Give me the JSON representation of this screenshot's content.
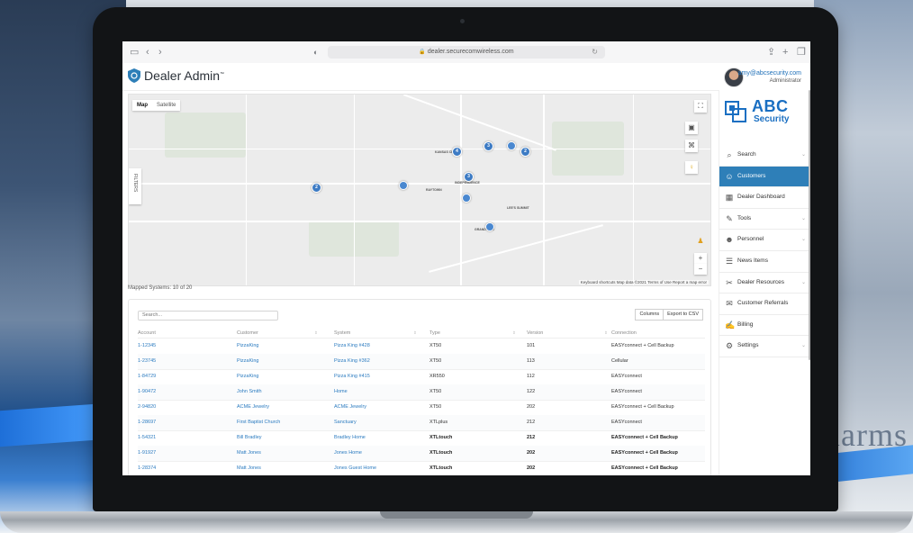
{
  "background": {
    "right_text": "larms"
  },
  "browser": {
    "url": "dealer.securecomwireless.com",
    "icons": {
      "sidebar": "sidebar-toggle-icon",
      "back": "chevron-left-icon",
      "forward": "chevron-right-icon",
      "privacy": "shield-half-icon",
      "reload": "reload-icon",
      "share": "share-icon",
      "new_tab": "plus-icon",
      "tabs": "tabs-icon"
    }
  },
  "header": {
    "title": "Dealer Admin",
    "trademark": "™",
    "user_email": "amy@abcsecurity.com",
    "user_role": "Administrator"
  },
  "map": {
    "tabs": [
      "Map",
      "Satellite"
    ],
    "active_tab": "Map",
    "filters_label": "FILTERS",
    "clusters": [
      "4",
      "3",
      "2",
      "3",
      "2"
    ],
    "footer": "Keyboard shortcuts   Map data ©2021   Terms of Use   Report a map error",
    "mapped_systems": "Mapped Systems: 10 of 20",
    "zoom_in": "+",
    "zoom_out": "−"
  },
  "table": {
    "search_placeholder": "Search...",
    "buttons": {
      "columns": "Columns",
      "export": "Export to CSV"
    },
    "headers": [
      "Account",
      "Customer",
      "System",
      "Type",
      "Version",
      "Connection"
    ],
    "rows": [
      {
        "account": "1-12345",
        "customer": "PizzaKing",
        "system": "Pizza King #428",
        "type": "XT50",
        "version": "101",
        "connection": "EASYconnect + Cell Backup",
        "bold": false
      },
      {
        "account": "1-23745",
        "customer": "PizzaKing",
        "system": "Pizza King #362",
        "type": "XT50",
        "version": "113",
        "connection": "Cellular",
        "bold": false
      },
      {
        "account": "1-84729",
        "customer": "PizzaKing",
        "system": "Pizza King #415",
        "type": "XR550",
        "version": "112",
        "connection": "EASYconnect",
        "bold": false
      },
      {
        "account": "1-90472",
        "customer": "John Smith",
        "system": "Home",
        "type": "XT50",
        "version": "122",
        "connection": "EASYconnect",
        "bold": false
      },
      {
        "account": "2-94820",
        "customer": "ACME Jewelry",
        "system": "ACME Jewelry",
        "type": "XT50",
        "version": "202",
        "connection": "EASYconnect + Cell Backup",
        "bold": false
      },
      {
        "account": "1-28697",
        "customer": "First Baptist Church",
        "system": "Sanctuary",
        "type": "XTLplus",
        "version": "212",
        "connection": "EASYconnect",
        "bold": false
      },
      {
        "account": "1-54321",
        "customer": "Bill Bradley",
        "system": "Bradley Home",
        "type": "XTLtouch",
        "version": "212",
        "connection": "EASYconnect + Cell Backup",
        "bold": true
      },
      {
        "account": "1-91927",
        "customer": "Matt Jones",
        "system": "Jones Home",
        "type": "XTLtouch",
        "version": "202",
        "connection": "EASYconnect + Cell Backup",
        "bold": true
      },
      {
        "account": "1-28374",
        "customer": "Matt Jones",
        "system": "Jones Guest Home",
        "type": "XTLtouch",
        "version": "202",
        "connection": "EASYconnect + Cell Backup",
        "bold": true
      }
    ]
  },
  "sidebar": {
    "brand": {
      "line1": "ABC",
      "line2": "Security"
    },
    "items": [
      {
        "label": "Search",
        "icon": "search-icon",
        "glyph": "⌕",
        "expandable": true,
        "active": false
      },
      {
        "label": "Customers",
        "icon": "customers-icon",
        "glyph": "☺",
        "expandable": false,
        "active": true
      },
      {
        "label": "Dealer Dashboard",
        "icon": "dashboard-icon",
        "glyph": "▦",
        "expandable": false,
        "active": false
      },
      {
        "label": "Tools",
        "icon": "wrench-icon",
        "glyph": "✎",
        "expandable": true,
        "active": false
      },
      {
        "label": "Personnel",
        "icon": "personnel-icon",
        "glyph": "☻",
        "expandable": true,
        "active": false
      },
      {
        "label": "News Items",
        "icon": "news-icon",
        "glyph": "☰",
        "expandable": false,
        "active": false
      },
      {
        "label": "Dealer Resources",
        "icon": "resources-icon",
        "glyph": "✂",
        "expandable": true,
        "active": false
      },
      {
        "label": "Customer Referrals",
        "icon": "referrals-icon",
        "glyph": "✉",
        "expandable": false,
        "active": false
      },
      {
        "label": "Billing",
        "icon": "billing-icon",
        "glyph": "✍",
        "expandable": false,
        "active": false
      },
      {
        "label": "Settings",
        "icon": "gear-icon",
        "glyph": "⚙",
        "expandable": true,
        "active": false
      }
    ]
  },
  "colors": {
    "accent": "#2e7fb8",
    "link": "#2b7bc0",
    "brand": "#1a6fc2",
    "pin": "#4a88d0"
  }
}
